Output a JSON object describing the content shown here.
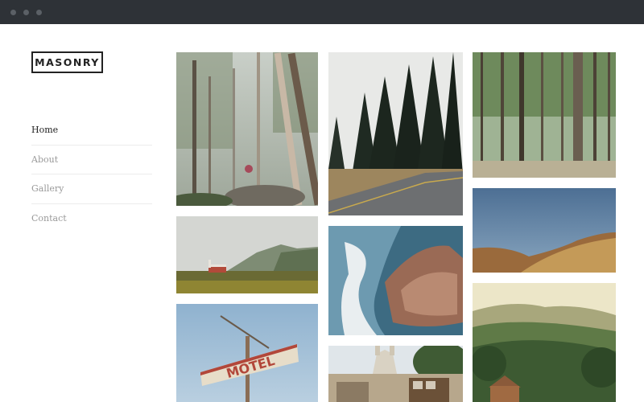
{
  "window": {
    "controls": [
      "close-dot",
      "minimize-dot",
      "maximize-dot"
    ]
  },
  "logo": {
    "text": "MASONRY"
  },
  "nav": {
    "items": [
      {
        "label": "Home",
        "active": true
      },
      {
        "label": "About",
        "active": false
      },
      {
        "label": "Gallery",
        "active": false
      },
      {
        "label": "Contact",
        "active": false
      }
    ]
  },
  "gallery": {
    "photos": [
      {
        "subject": "misty-birch-forest",
        "column": 1
      },
      {
        "subject": "church-on-hillside",
        "column": 1
      },
      {
        "subject": "motel-sign",
        "column": 1,
        "sign_text": "MOTEL"
      },
      {
        "subject": "pine-forest-road",
        "column": 2
      },
      {
        "subject": "rocky-coast-waves",
        "column": 2
      },
      {
        "subject": "old-town-tram",
        "column": 2
      },
      {
        "subject": "tall-pine-trees",
        "column": 3
      },
      {
        "subject": "dune-hills-blue-sky",
        "column": 3
      },
      {
        "subject": "forest-cabin-valley",
        "column": 3
      }
    ]
  },
  "colors": {
    "titlebar": "#2e3237",
    "active_nav": "#222222",
    "inactive_nav": "#9a9a9a"
  }
}
